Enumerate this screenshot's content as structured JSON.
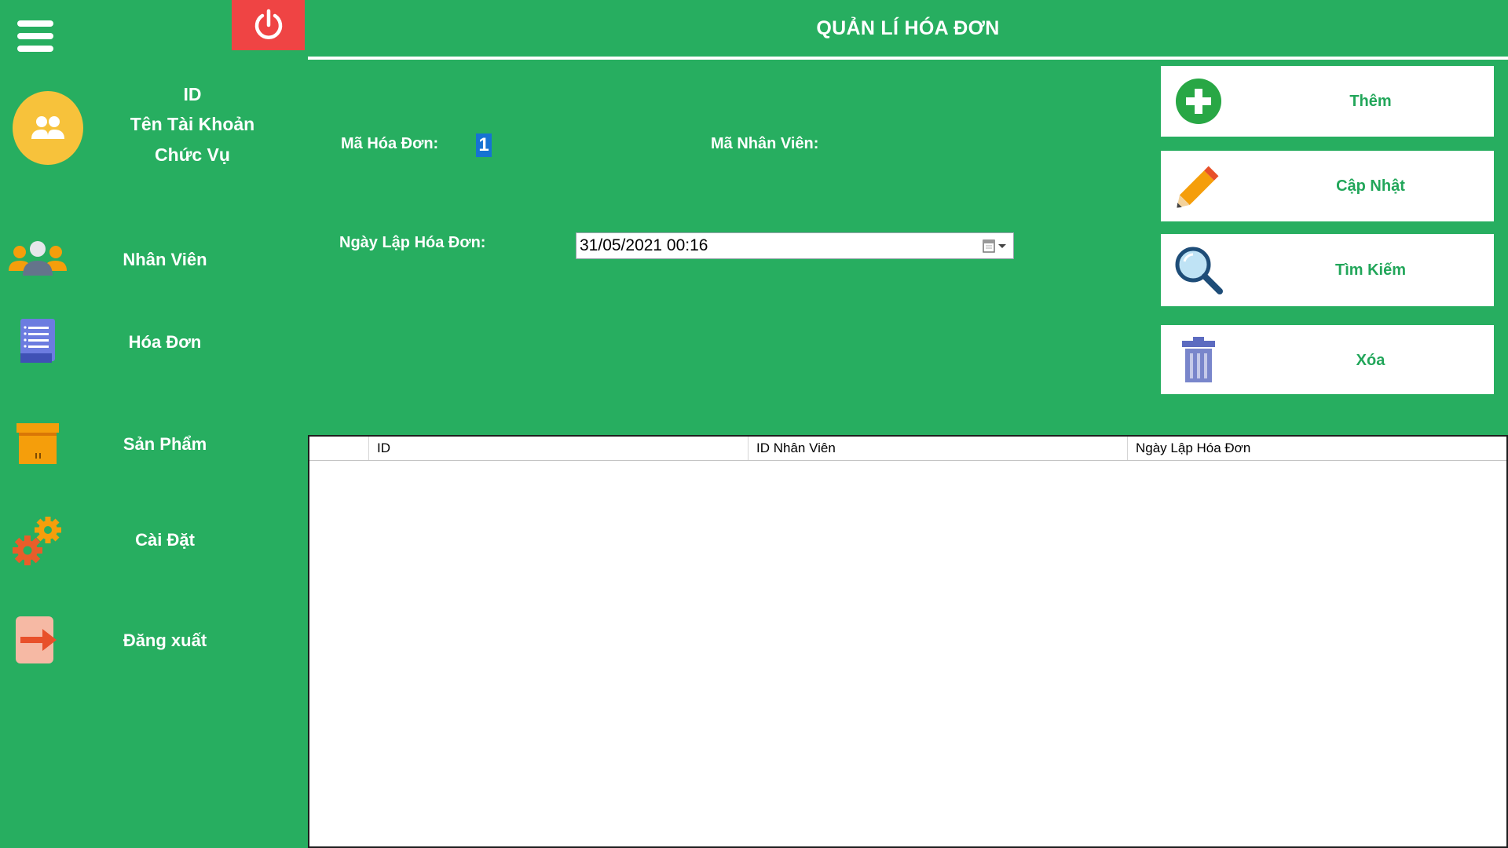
{
  "header": {
    "title": "QUẢN LÍ HÓA ĐƠN"
  },
  "user_info": {
    "id_label": "ID",
    "account_label": "Tên Tài Khoản",
    "role_label": "Chức Vụ"
  },
  "sidebar": {
    "items": [
      {
        "label": "Nhân Viên",
        "icon": "users-icon"
      },
      {
        "label": "Hóa Đơn",
        "icon": "invoice-icon"
      },
      {
        "label": "Sản Phẩm",
        "icon": "box-icon"
      },
      {
        "label": "Cài Đặt",
        "icon": "gears-icon"
      },
      {
        "label": "Đăng xuất",
        "icon": "logout-icon"
      }
    ]
  },
  "form": {
    "ma_hoa_don_label": "Mã Hóa Đơn:",
    "ma_hoa_don_value": "1",
    "ma_nhan_vien_label": "Mã Nhân Viên:",
    "ngay_lap_label": "Ngày Lập Hóa Đơn:",
    "ngay_lap_value": "31/05/2021 00:16"
  },
  "actions": [
    {
      "label": "Thêm",
      "icon": "plus-icon"
    },
    {
      "label": "Cập Nhật",
      "icon": "pencil-icon"
    },
    {
      "label": "Tìm Kiếm",
      "icon": "search-icon"
    },
    {
      "label": "Xóa",
      "icon": "trash-icon"
    }
  ],
  "table": {
    "columns": [
      "ID",
      "ID Nhân Viên",
      "Ngày Lập Hóa Đơn"
    ],
    "rows": []
  },
  "colors": {
    "background": "#27ae60",
    "power_button": "#ef4444",
    "avatar": "#f7c23b",
    "action_text": "#22a65a",
    "selected_value": "#1673d3"
  }
}
